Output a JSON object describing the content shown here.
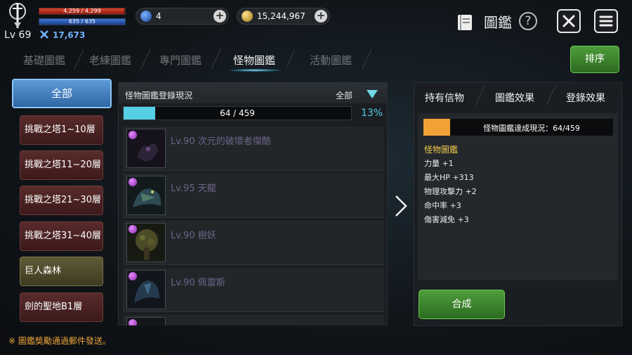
{
  "player": {
    "level": "Lv 69",
    "hp_text": "4,259 / 4,299",
    "hp_fraction": 0.99,
    "mp_text": "635 / 635",
    "mp_fraction": 1.0,
    "combat_power": "17,673"
  },
  "resources": {
    "gems": "4",
    "gold": "15,244,967"
  },
  "header": {
    "title": "圖鑑",
    "help": "?"
  },
  "tabs": [
    {
      "label": "基礎圖鑑",
      "active": false
    },
    {
      "label": "老練圖鑑",
      "active": false
    },
    {
      "label": "專門圖鑑",
      "active": false
    },
    {
      "label": "怪物圖鑑",
      "active": true
    },
    {
      "label": "活動圖鑑",
      "active": false
    }
  ],
  "sort_button": "排序",
  "categories": {
    "all": "全部",
    "items": [
      {
        "label": "挑戰之塔1~10層",
        "style": "red"
      },
      {
        "label": "挑戰之塔11~20層",
        "style": "red"
      },
      {
        "label": "挑戰之塔21~30層",
        "style": "red"
      },
      {
        "label": "挑戰之塔31~40層",
        "style": "red"
      },
      {
        "label": "巨人森林",
        "style": "gold"
      },
      {
        "label": "劍的聖地B1層",
        "style": "red"
      }
    ]
  },
  "collection": {
    "title": "怪物圖鑑登錄現況",
    "filter": "全部",
    "progress_text": "64 / 459",
    "progress_fraction": 0.139,
    "percent": "13%",
    "monsters": [
      {
        "name": "Lv.90 次元的破壞者傑酷"
      },
      {
        "name": "Lv.95 天龍"
      },
      {
        "name": "Lv.90 樹妖"
      },
      {
        "name": "Lv.90 佩雷斯"
      }
    ]
  },
  "right_panel": {
    "tabs": [
      "持有信物",
      "圖鑑效果",
      "登錄效果"
    ],
    "progress_text": "怪物圖鑑達成現況：64/459",
    "progress_fraction": 0.139,
    "effect_title": "怪物圖鑑",
    "effects": [
      "力量 +1",
      "最大HP +313",
      "物理攻擊力 +2",
      "命中率 +3",
      "傷害減免 +3"
    ],
    "synth_button": "合成"
  },
  "notice": "※ 圖鑑獎勵通過郵件發送。",
  "colors": {
    "accent_cyan": "#56cfe6",
    "progress_orange": "#f0a236",
    "green_button": "#3f8a2f",
    "notice_orange": "#e8a33a"
  }
}
